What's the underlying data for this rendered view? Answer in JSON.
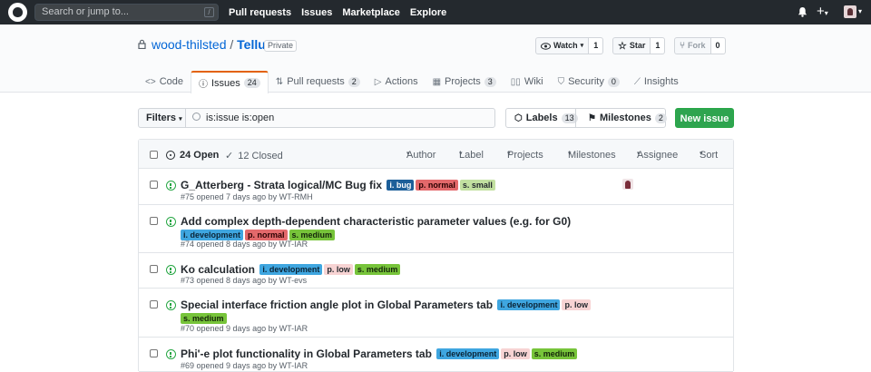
{
  "header": {
    "search_placeholder": "Search or jump to...",
    "search_shortcut": "/",
    "nav": [
      "Pull requests",
      "Issues",
      "Marketplace",
      "Explore"
    ],
    "plus": "+"
  },
  "repo": {
    "owner": "wood-thilsted",
    "separator": "/",
    "name": "Tellus",
    "visibility": "Private",
    "watch": {
      "label": "Watch",
      "count": "1"
    },
    "star": {
      "label": "Star",
      "count": "1"
    },
    "fork": {
      "label": "Fork",
      "count": "0"
    }
  },
  "tabs": [
    {
      "label": "Code",
      "count": null,
      "icon": "code-icon"
    },
    {
      "label": "Issues",
      "count": "24",
      "icon": "issue-icon"
    },
    {
      "label": "Pull requests",
      "count": "2",
      "icon": "pr-icon"
    },
    {
      "label": "Actions",
      "count": null,
      "icon": "play-icon"
    },
    {
      "label": "Projects",
      "count": "3",
      "icon": "project-icon"
    },
    {
      "label": "Wiki",
      "count": null,
      "icon": "book-icon"
    },
    {
      "label": "Security",
      "count": "0",
      "icon": "shield-icon"
    },
    {
      "label": "Insights",
      "count": null,
      "icon": "graph-icon"
    }
  ],
  "filterbar": {
    "filters_label": "Filters",
    "query": "is:issue is:open",
    "labels": {
      "label": "Labels",
      "count": "13"
    },
    "milestones": {
      "label": "Milestones",
      "count": "2"
    },
    "new_issue": "New issue"
  },
  "list_header": {
    "open": "24 Open",
    "closed": "12 Closed",
    "menus": [
      "Author",
      "Label",
      "Projects",
      "Milestones",
      "Assignee",
      "Sort"
    ]
  },
  "colors": {
    "i_bug": "#1d5f99",
    "p_normal": "#e3696b",
    "s_small": "#c2e0a0",
    "i_development": "#3fa6e0",
    "s_medium": "#77c43a",
    "p_low": "#f7d3d3",
    "accent_green": "#2ea44f",
    "link_blue": "#0366d6"
  },
  "issues": [
    {
      "title": "G_Atterberg - Strata logical/MC Bug fix",
      "labels": [
        {
          "text": "i. bug",
          "bg": "#1d5f99",
          "fg": "#ffffff"
        },
        {
          "text": "p. normal",
          "bg": "#e3696b",
          "fg": "#2b0000"
        },
        {
          "text": "s. small",
          "bg": "#c2e0a0",
          "fg": "#24292e"
        }
      ],
      "meta": "#75 opened 7 days ago by WT-RMH",
      "assignee": true
    },
    {
      "title": "Add complex depth-dependent characteristic parameter values (e.g. for G0)",
      "labels": [
        {
          "text": "i. development",
          "bg": "#3fa6e0",
          "fg": "#0b2436"
        },
        {
          "text": "p. normal",
          "bg": "#e3696b",
          "fg": "#2b0000"
        },
        {
          "text": "s. medium",
          "bg": "#77c43a",
          "fg": "#14250a"
        }
      ],
      "meta": "#74 opened 8 days ago by WT-IAR",
      "assignee": false
    },
    {
      "title": "Ko calculation",
      "labels": [
        {
          "text": "i. development",
          "bg": "#3fa6e0",
          "fg": "#0b2436"
        },
        {
          "text": "p. low",
          "bg": "#f7d3d3",
          "fg": "#24292e"
        },
        {
          "text": "s. medium",
          "bg": "#77c43a",
          "fg": "#14250a"
        }
      ],
      "meta": "#73 opened 8 days ago by WT-evs",
      "assignee": false
    },
    {
      "title": "Special interface friction angle plot in Global Parameters tab",
      "labels": [
        {
          "text": "i. development",
          "bg": "#3fa6e0",
          "fg": "#0b2436"
        },
        {
          "text": "p. low",
          "bg": "#f7d3d3",
          "fg": "#24292e"
        },
        {
          "text": "s. medium",
          "bg": "#77c43a",
          "fg": "#14250a"
        }
      ],
      "meta": "#70 opened 9 days ago by WT-IAR",
      "assignee": false
    },
    {
      "title": "Phi'-e plot functionality in Global Parameters tab",
      "labels": [
        {
          "text": "i. development",
          "bg": "#3fa6e0",
          "fg": "#0b2436"
        },
        {
          "text": "p. low",
          "bg": "#f7d3d3",
          "fg": "#24292e"
        },
        {
          "text": "s. medium",
          "bg": "#77c43a",
          "fg": "#14250a"
        }
      ],
      "meta": "#69 opened 9 days ago by WT-IAR",
      "assignee": false
    }
  ]
}
